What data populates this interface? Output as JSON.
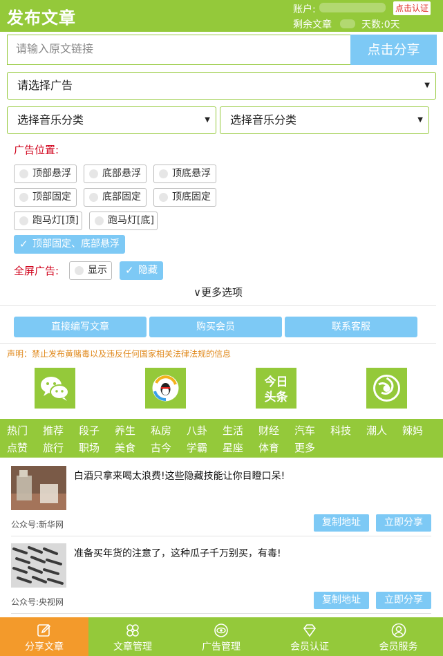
{
  "header": {
    "title": "发布文章",
    "account_label": "账户:",
    "verify_label": "点击认证",
    "remaining_label": "剩余文章",
    "days_label": "天数:0天",
    "bg_color": "#94c93a"
  },
  "url_input": {
    "placeholder": "请输入原文链接",
    "value": ""
  },
  "share_button": {
    "label": "点击分享"
  },
  "ad_select": {
    "value": "请选择广告"
  },
  "music_select_1": {
    "value": "选择音乐分类"
  },
  "music_select_2": {
    "value": "选择音乐分类"
  },
  "ad_position": {
    "label": "广告位置:",
    "options": [
      {
        "label": "顶部悬浮",
        "checked": false
      },
      {
        "label": "底部悬浮",
        "checked": false
      },
      {
        "label": "顶底悬浮",
        "checked": false
      },
      {
        "label": "顶部固定",
        "checked": false
      },
      {
        "label": "底部固定",
        "checked": false
      },
      {
        "label": "顶底固定",
        "checked": false
      },
      {
        "label": "跑马灯[顶]",
        "checked": false
      },
      {
        "label": "跑马灯[底]",
        "checked": false
      },
      {
        "label": "顶部固定、底部悬浮",
        "checked": true
      }
    ]
  },
  "fullscreen_ad": {
    "label": "全屏广告:",
    "options": [
      {
        "label": "显示",
        "checked": false
      },
      {
        "label": "隐藏",
        "checked": true
      }
    ]
  },
  "more_options": {
    "label": "∨更多选项"
  },
  "actions": [
    {
      "label": "直接编写文章"
    },
    {
      "label": "购买会员"
    },
    {
      "label": "联系客服"
    }
  ],
  "notice": "声明：禁止发布黄赌毒以及违反任何国家相关法律法规的信息",
  "platforms": [
    {
      "name": "wechat-icon"
    },
    {
      "name": "qq-icon"
    },
    {
      "name": "toutiao-icon",
      "text_top": "今日",
      "text_bottom": "头条"
    },
    {
      "name": "sina-icon"
    }
  ],
  "categories": [
    "热门",
    "推荐",
    "段子",
    "养生",
    "私房",
    "八卦",
    "生活",
    "财经",
    "汽车",
    "科技",
    "潮人",
    "辣妈",
    "点赞",
    "旅行",
    "职场",
    "美食",
    "古今",
    "学霸",
    "星座",
    "体育",
    "更多"
  ],
  "articles": [
    {
      "title": "白酒只拿来喝太浪费!这些隐藏技能让你目瞪口呆!",
      "source": "公众号:新华网",
      "copy_label": "复制地址",
      "share_label": "立即分享"
    },
    {
      "title": "准备买年货的注意了，这种瓜子千万别买，有毒!",
      "source": "公众号:央视网",
      "copy_label": "复制地址",
      "share_label": "立即分享"
    }
  ],
  "bottom_nav": [
    {
      "label": "分享文章",
      "icon": "edit-icon",
      "active": true
    },
    {
      "label": "文章管理",
      "icon": "grid-icon",
      "active": false
    },
    {
      "label": "广告管理",
      "icon": "eye-icon",
      "active": false
    },
    {
      "label": "会员认证",
      "icon": "diamond-icon",
      "active": false
    },
    {
      "label": "会员服务",
      "icon": "user-icon",
      "active": false
    }
  ],
  "colors": {
    "green": "#94c93a",
    "blue": "#7dc9f5",
    "orange": "#f39a2b",
    "red": "#d0021b"
  }
}
